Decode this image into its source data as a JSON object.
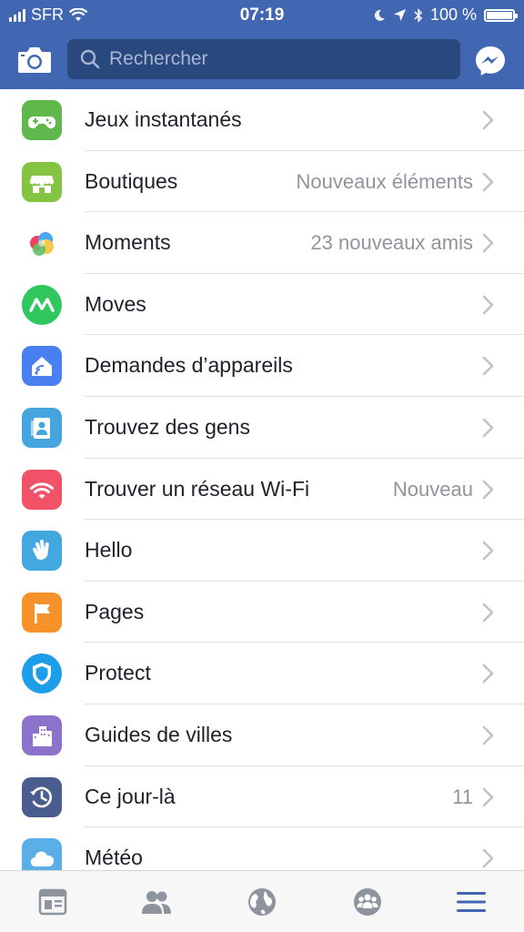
{
  "status_bar": {
    "carrier": "SFR",
    "time": "07:19",
    "battery": "100 %",
    "battery_level": 1.0
  },
  "header": {
    "search_placeholder": "Rechercher",
    "camera_icon": "camera-icon",
    "messenger_icon": "messenger-icon"
  },
  "colors": {
    "header_blue": "#4267b2",
    "search_blue": "#29487d",
    "active_tab": "#4267b2",
    "inactive_tab": "#8d949e"
  },
  "menu": {
    "items": [
      {
        "label": "Jeux instantanés",
        "meta": "",
        "icon": "gamepad-icon",
        "color": "#5fb84c"
      },
      {
        "label": "Boutiques",
        "meta": "Nouveaux éléments",
        "icon": "shop-icon",
        "color": "#85c343"
      },
      {
        "label": "Moments",
        "meta": "23 nouveaux amis",
        "icon": "moments-icon",
        "color": "#ffffff"
      },
      {
        "label": "Moves",
        "meta": "",
        "icon": "moves-icon",
        "color": "#30c85e"
      },
      {
        "label": "Demandes d’appareils",
        "meta": "",
        "icon": "device-requests-icon",
        "color": "#4a7ff2"
      },
      {
        "label": "Trouvez des gens",
        "meta": "",
        "icon": "find-people-icon",
        "color": "#45a5de"
      },
      {
        "label": "Trouver un réseau Wi-Fi",
        "meta": "Nouveau",
        "icon": "wifi-icon",
        "color": "#f25268"
      },
      {
        "label": "Hello",
        "meta": "",
        "icon": "hello-wave-icon",
        "color": "#43a7e0"
      },
      {
        "label": "Pages",
        "meta": "",
        "icon": "pages-flag-icon",
        "color": "#f7912a"
      },
      {
        "label": "Protect",
        "meta": "",
        "icon": "shield-icon",
        "color": "#1c9ee8"
      },
      {
        "label": "Guides de villes",
        "meta": "",
        "icon": "city-guides-icon",
        "color": "#8c72cb"
      },
      {
        "label": "Ce jour-là",
        "meta": "11",
        "icon": "on-this-day-icon",
        "color": "#4a5d8f"
      },
      {
        "label": "Météo",
        "meta": "",
        "icon": "weather-icon",
        "color": "#5ab0e6"
      }
    ]
  },
  "tabbar": {
    "tabs": [
      {
        "name": "news-feed",
        "icon": "news-feed-icon",
        "active": false
      },
      {
        "name": "friends",
        "icon": "friends-icon",
        "active": false
      },
      {
        "name": "notifications",
        "icon": "globe-icon",
        "active": false
      },
      {
        "name": "groups",
        "icon": "groups-icon",
        "active": false
      },
      {
        "name": "menu",
        "icon": "menu-icon",
        "active": true
      }
    ]
  }
}
